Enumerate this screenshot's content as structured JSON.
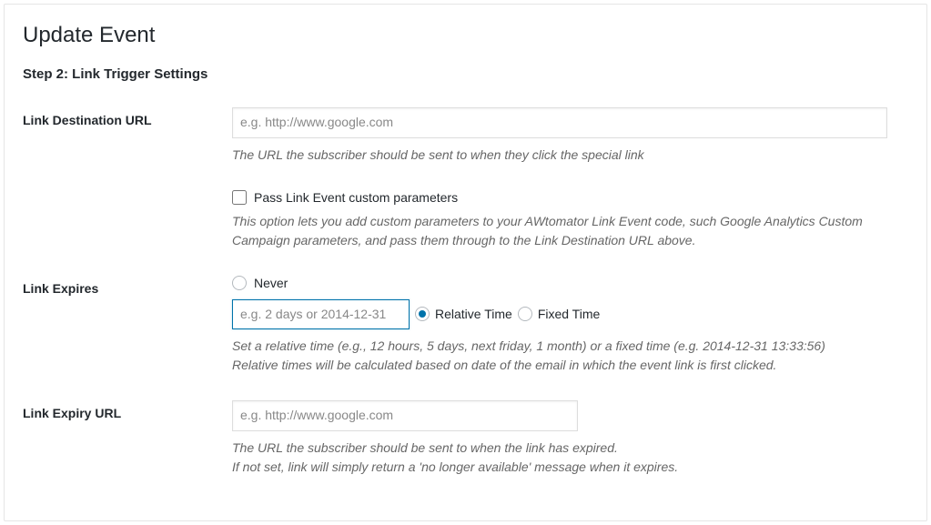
{
  "page_title": "Update Event",
  "step_title": "Step 2: Link Trigger Settings",
  "fields": {
    "destination": {
      "label": "Link Destination URL",
      "placeholder": "e.g. http://www.google.com",
      "description": "The URL the subscriber should be sent to when they click the special link"
    },
    "pass_params": {
      "checkbox_label": "Pass Link Event custom parameters",
      "description": "This option lets you add custom parameters to your AWtomator Link Event code, such Google Analytics Custom Campaign parameters, and pass them through to the Link Destination URL above."
    },
    "expires": {
      "label": "Link Expires",
      "never_label": "Never",
      "placeholder": "e.g. 2 days or 2014-12-31",
      "relative_label": "Relative Time",
      "fixed_label": "Fixed Time",
      "description_line1": "Set a relative time (e.g., 12 hours, 5 days, next friday, 1 month) or a fixed time (e.g. 2014-12-31 13:33:56)",
      "description_line2": "Relative times will be calculated based on date of the email in which the event link is first clicked."
    },
    "expiry_url": {
      "label": "Link Expiry URL",
      "placeholder": "e.g. http://www.google.com",
      "description_line1": "The URL the subscriber should be sent to when the link has expired.",
      "description_line2": "If not set, link will simply return a 'no longer available' message when it expires."
    }
  }
}
